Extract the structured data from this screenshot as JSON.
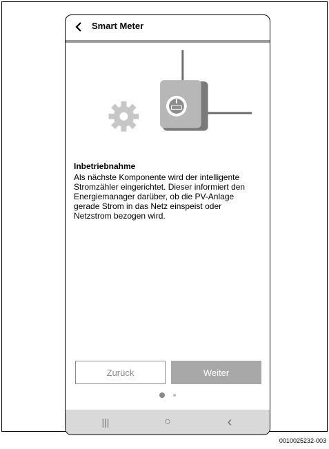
{
  "header": {
    "title": "Smart Meter",
    "back_icon": "chevron-left-icon"
  },
  "progress": {
    "fraction": 1.0,
    "color": "#9a9a9a"
  },
  "illustration": {
    "gear_icon": "gear-icon",
    "meter_icon": "smart-meter-icon"
  },
  "content": {
    "title": "Inbetriebnahme",
    "body": "Als nächste Komponente wird der intelligente Stromzähler eingerichtet. Dieser informiert den Energiemanager darüber, ob die PV-Anlage gerade Strom in das Netz einspeist oder Netzstrom bezogen wird."
  },
  "buttons": {
    "back_label": "Zurück",
    "next_label": "Weiter"
  },
  "pager": {
    "count": 2,
    "active_index": 0
  },
  "navbar": {
    "recents": "|||",
    "home": "○",
    "back": "‹"
  },
  "figure_id": "0010025232-003"
}
